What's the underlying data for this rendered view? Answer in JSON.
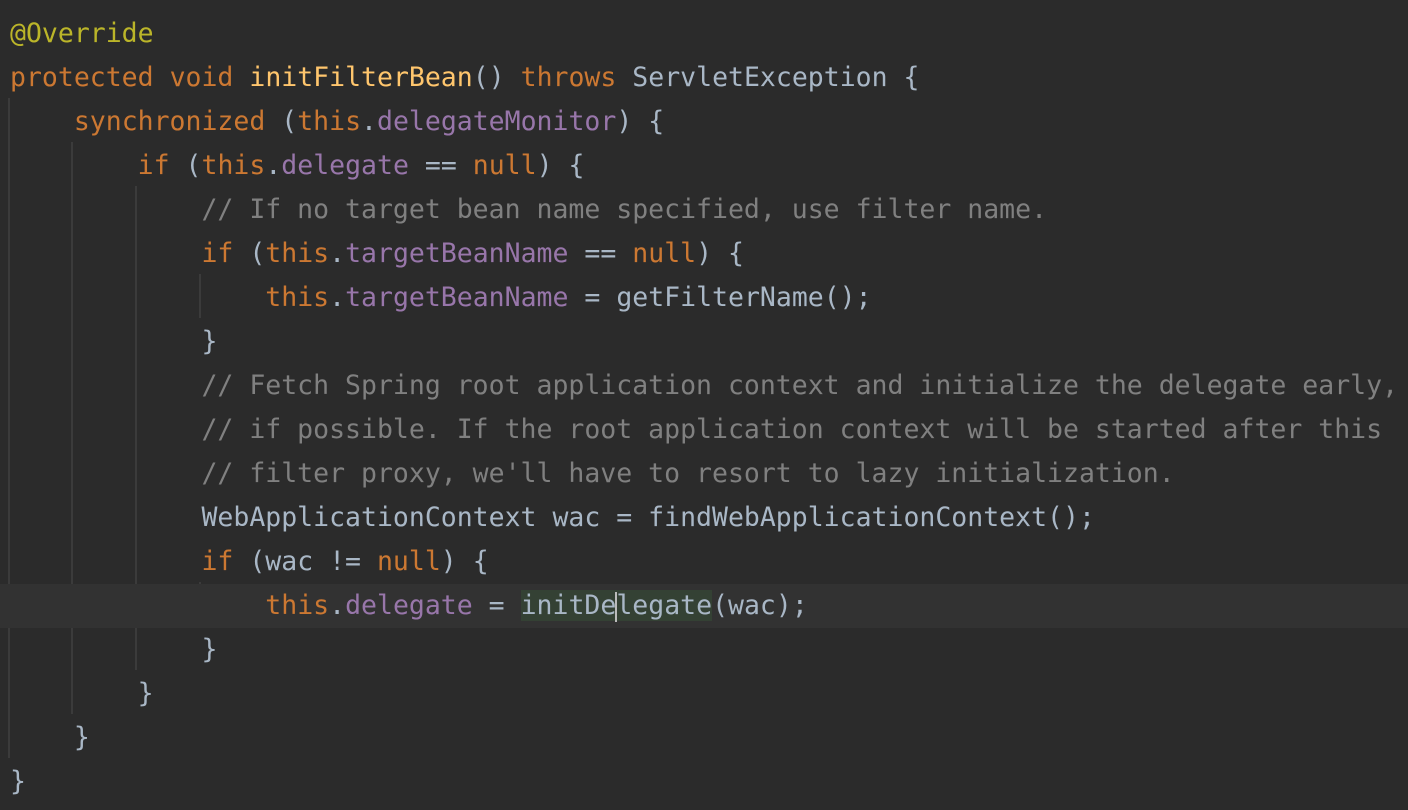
{
  "editor": {
    "language": "java",
    "theme": "darcula",
    "lines": [
      {
        "text": "@Override"
      },
      {
        "text": "protected void initFilterBean() throws ServletException {"
      },
      {
        "text": "    synchronized (this.delegateMonitor) {"
      },
      {
        "text": "        if (this.delegate == null) {"
      },
      {
        "text": "            // If no target bean name specified, use filter name."
      },
      {
        "text": "            if (this.targetBeanName == null) {"
      },
      {
        "text": "                this.targetBeanName = getFilterName();"
      },
      {
        "text": "            }"
      },
      {
        "text": "            // Fetch Spring root application context and initialize the delegate early,"
      },
      {
        "text": "            // if possible. If the root application context will be started after this"
      },
      {
        "text": "            // filter proxy, we'll have to resort to lazy initialization."
      },
      {
        "text": "            WebApplicationContext wac = findWebApplicationContext();"
      },
      {
        "text": "            if (wac != null) {"
      },
      {
        "text": "                this.delegate = initDelegate(wac);"
      },
      {
        "text": "            }"
      },
      {
        "text": "        }"
      },
      {
        "text": "    }"
      },
      {
        "text": "}"
      }
    ],
    "current_line_index": 13,
    "highlighted_identifier": "initDelegate",
    "colors": {
      "background": "#2b2b2b",
      "current_line": "#323232",
      "keyword": "#cc7832",
      "annotation": "#bbb529",
      "method": "#ffc66d",
      "field": "#9876aa",
      "comment": "#808080",
      "plain": "#a9b7c6",
      "identifier_highlight": "#344134"
    }
  }
}
